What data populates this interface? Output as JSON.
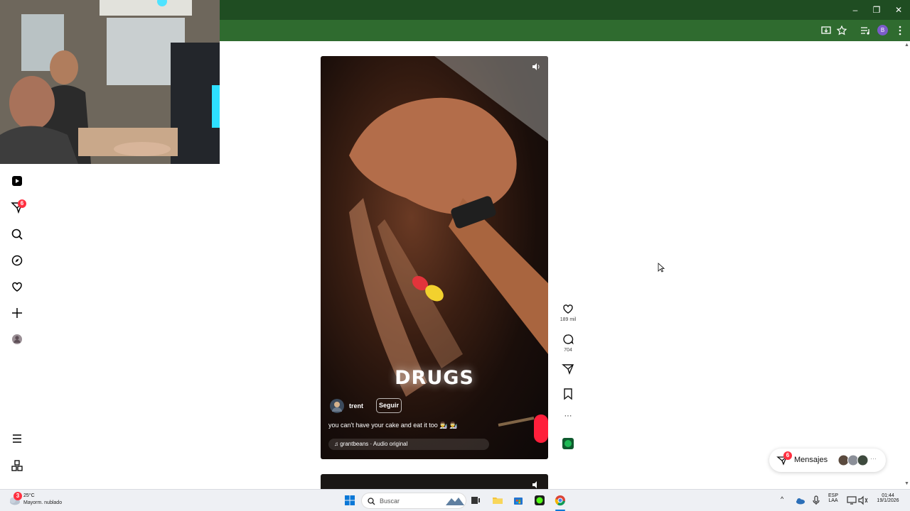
{
  "browser": {
    "window_controls": {
      "minimize": "–",
      "restore": "❐",
      "close": "✕"
    },
    "profile_initial": "B"
  },
  "nav": {
    "messages_badge": "6",
    "items": [
      "reels-icon",
      "messages-icon",
      "search-icon",
      "explore-icon",
      "notifications-icon",
      "create-icon",
      "profile-icon",
      "more-icon",
      "apps-icon"
    ]
  },
  "reel": {
    "overlay_text": "DRUGS",
    "username": "trent",
    "follow_label": "Seguir",
    "caption": "you can't have your cake and eat it too 👨‍🔬 👨‍🔬",
    "audio": "grantbeans · Audio original"
  },
  "actions": {
    "likes": "189 mil",
    "comments": "704",
    "more": "···"
  },
  "messages": {
    "label": "Mensajes",
    "badge": "6",
    "more": "···"
  },
  "taskbar": {
    "weather_badge": "3",
    "weather_temp": "25°C",
    "weather_desc": "Mayorm. nublado",
    "search_placeholder": "Buscar",
    "lang_top": "ESP",
    "lang_bottom": "LAA",
    "time": "01:44",
    "date": "19/1/2026",
    "chevron": "^"
  },
  "colors": {
    "titlebar": "#1f4d22",
    "toolbar": "#2f6b2f",
    "badge": "#ff3040",
    "accent_green": "#1db954"
  }
}
